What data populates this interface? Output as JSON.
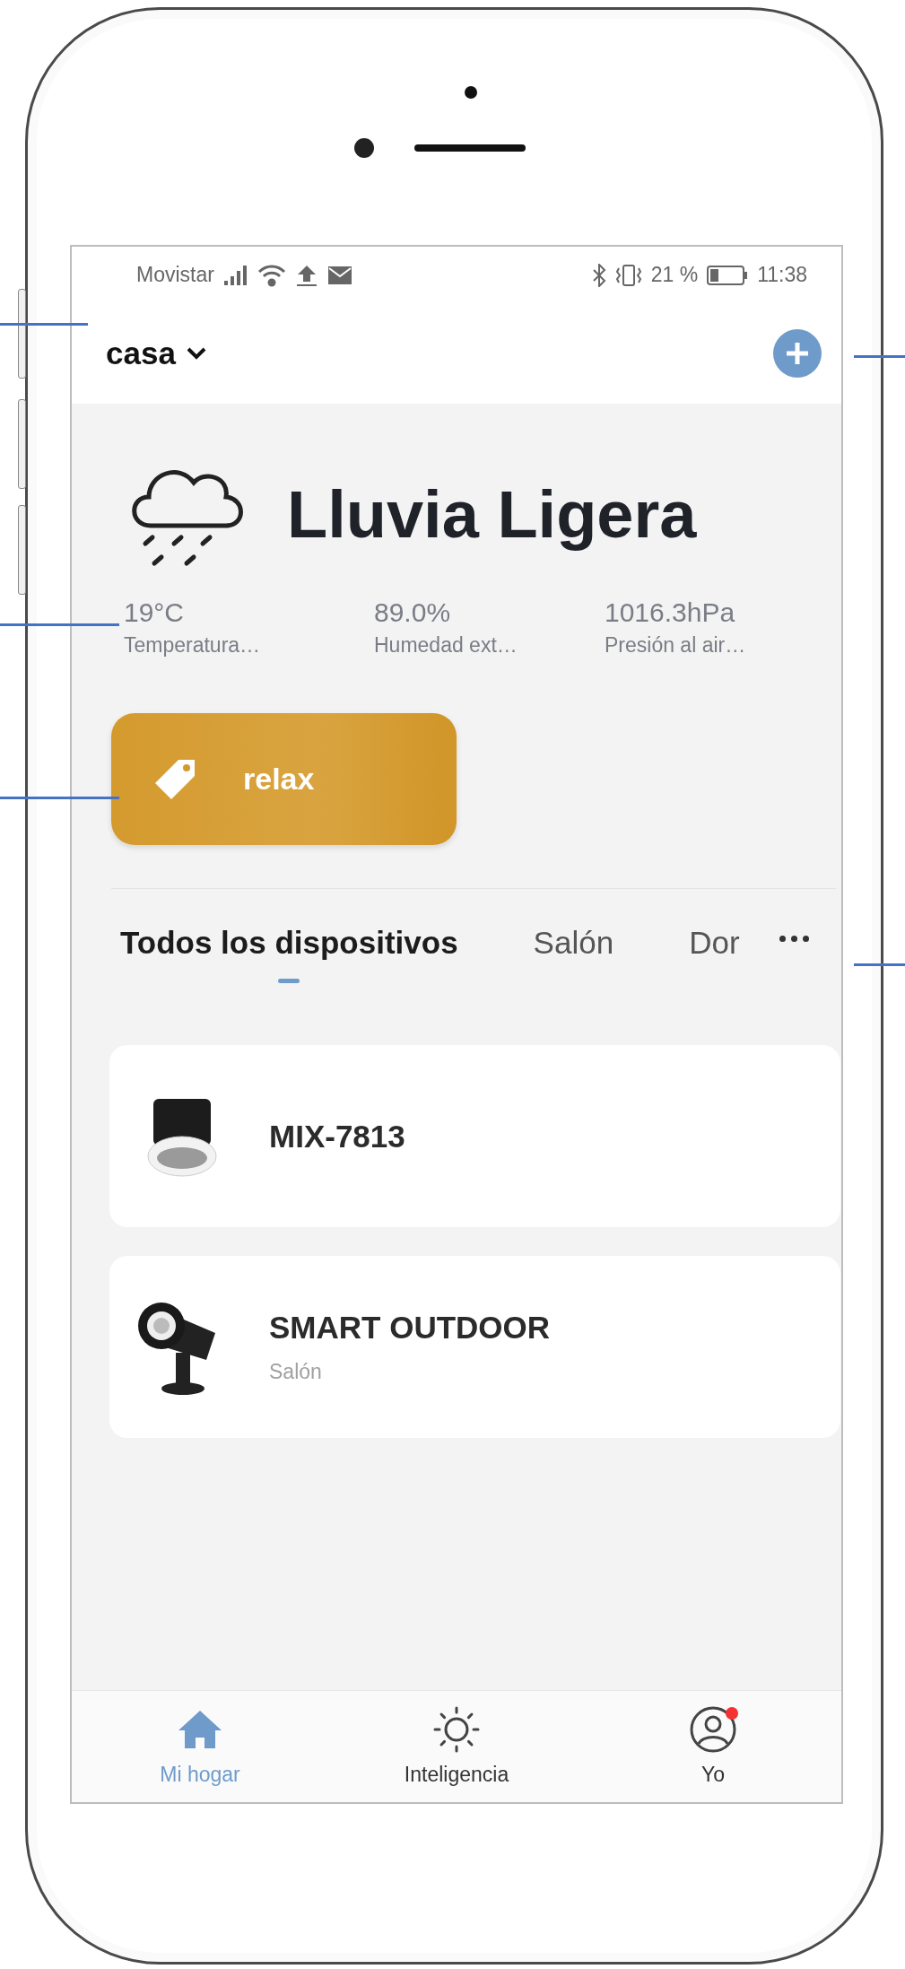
{
  "status_bar": {
    "carrier": "Movistar",
    "battery": "21 %",
    "time": "11:38"
  },
  "header": {
    "home": "casa"
  },
  "weather": {
    "condition": "Lluvia Ligera",
    "stats": [
      {
        "value": "19°C",
        "label": "Temperatura…"
      },
      {
        "value": "89.0%",
        "label": "Humedad ext…"
      },
      {
        "value": "1016.3hPa",
        "label": "Presión al air…"
      }
    ]
  },
  "scenes": [
    {
      "name": "relax"
    }
  ],
  "room_tabs": [
    {
      "label": "Todos los dispositivos",
      "selected": true
    },
    {
      "label": "Salón",
      "selected": false
    },
    {
      "label": "Dor",
      "selected": false
    }
  ],
  "devices": [
    {
      "name": "MIX-7813",
      "kind": "downlight"
    },
    {
      "name": "SMART OUTDOOR",
      "room": "Salón",
      "kind": "spotlight"
    }
  ],
  "bottom_nav": [
    {
      "label": "Mi hogar",
      "kind": "home",
      "selected": true,
      "badge": false
    },
    {
      "label": "Inteligencia",
      "kind": "smart",
      "selected": false,
      "badge": false
    },
    {
      "label": "Yo",
      "kind": "profile",
      "selected": false,
      "badge": true
    }
  ]
}
